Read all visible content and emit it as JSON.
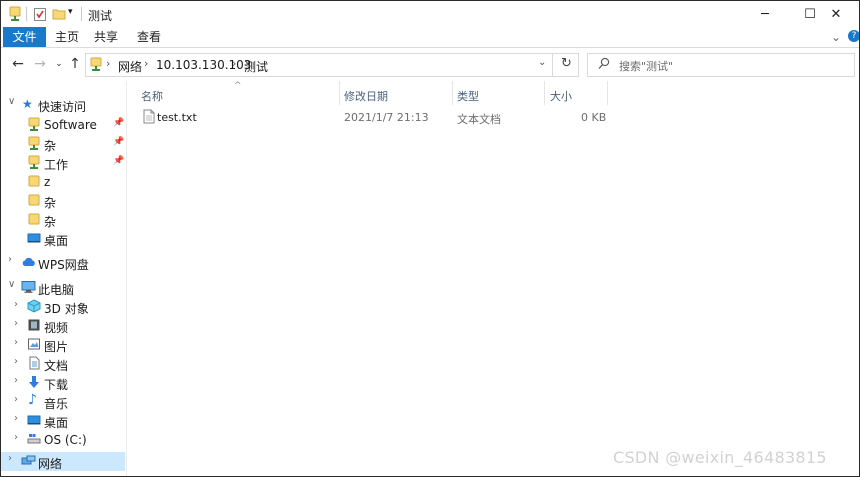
{
  "window": {
    "title": "测试",
    "controls": {
      "minimize": "─",
      "maximize": "☐",
      "close": "✕"
    }
  },
  "ribbon": {
    "tabs": [
      "文件",
      "主页",
      "共享",
      "查看"
    ],
    "expand_chevron": "⌄",
    "help": "?"
  },
  "address": {
    "crumbs": [
      "网络",
      "10.103.130.103",
      "测试"
    ],
    "search_placeholder": "搜索\"测试\""
  },
  "nav": {
    "quick_access": "快速访问",
    "quick_items": [
      {
        "label": "Software",
        "pinned": true
      },
      {
        "label": "杂",
        "pinned": true
      },
      {
        "label": "工作",
        "pinned": true
      },
      {
        "label": "z",
        "pinned": false
      },
      {
        "label": "杂",
        "pinned": false
      },
      {
        "label": "杂",
        "pinned": false
      },
      {
        "label": "桌面",
        "pinned": false
      }
    ],
    "wps": "WPS网盘",
    "this_pc": "此电脑",
    "pc_items": [
      "3D 对象",
      "视频",
      "图片",
      "文档",
      "下载",
      "音乐",
      "桌面",
      "OS (C:)"
    ],
    "network": "网络"
  },
  "columns": {
    "name": "名称",
    "modified": "修改日期",
    "type": "类型",
    "size": "大小"
  },
  "files": [
    {
      "name": "test.txt",
      "modified": "2021/1/7 21:13",
      "type": "文本文档",
      "size": "0 KB"
    }
  ],
  "watermark": "CSDN @weixin_46483815",
  "colors": {
    "accent": "#1979ca",
    "selected": "#cce8ff",
    "folder": "#f8d775"
  }
}
